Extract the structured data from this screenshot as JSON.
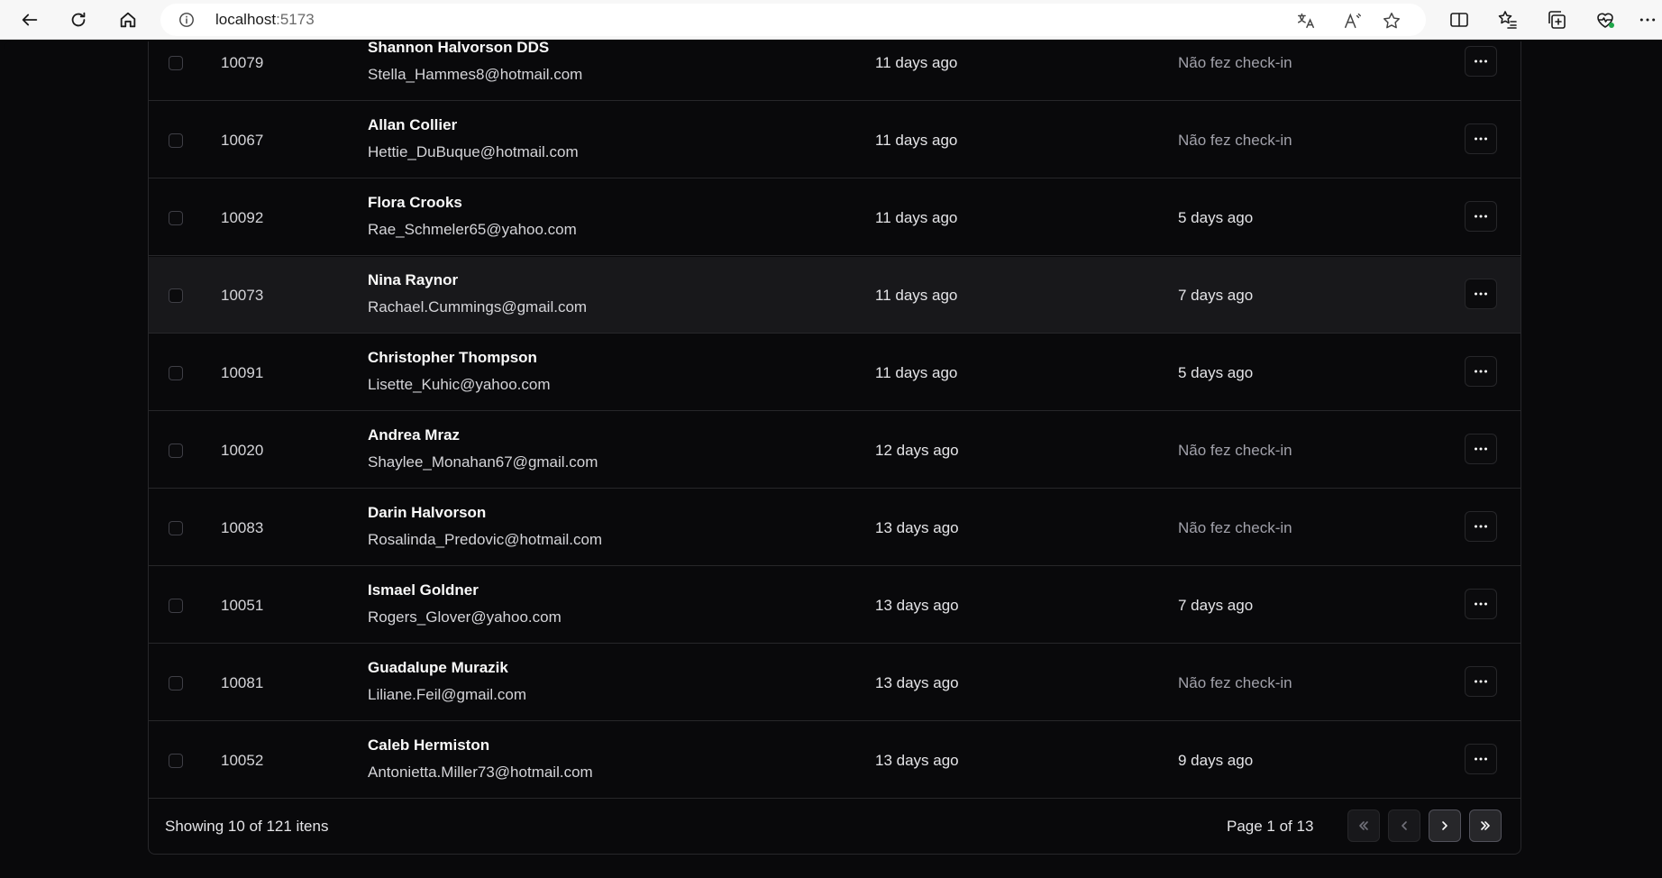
{
  "browser": {
    "url_host": "localhost",
    "url_port": ":5173"
  },
  "rows": [
    {
      "code": "10079",
      "name": "Shannon Halvorson DDS",
      "email": "Stella_Hammes8@hotmail.com",
      "created": "11 days ago",
      "checkin": "Não fez check-in"
    },
    {
      "code": "10067",
      "name": "Allan Collier",
      "email": "Hettie_DuBuque@hotmail.com",
      "created": "11 days ago",
      "checkin": "Não fez check-in"
    },
    {
      "code": "10092",
      "name": "Flora Crooks",
      "email": "Rae_Schmeler65@yahoo.com",
      "created": "11 days ago",
      "checkin": "5 days ago"
    },
    {
      "code": "10073",
      "name": "Nina Raynor",
      "email": "Rachael.Cummings@gmail.com",
      "created": "11 days ago",
      "checkin": "7 days ago"
    },
    {
      "code": "10091",
      "name": "Christopher Thompson",
      "email": "Lisette_Kuhic@yahoo.com",
      "created": "11 days ago",
      "checkin": "5 days ago"
    },
    {
      "code": "10020",
      "name": "Andrea Mraz",
      "email": "Shaylee_Monahan67@gmail.com",
      "created": "12 days ago",
      "checkin": "Não fez check-in"
    },
    {
      "code": "10083",
      "name": "Darin Halvorson",
      "email": "Rosalinda_Predovic@hotmail.com",
      "created": "13 days ago",
      "checkin": "Não fez check-in"
    },
    {
      "code": "10051",
      "name": "Ismael Goldner",
      "email": "Rogers_Glover@yahoo.com",
      "created": "13 days ago",
      "checkin": "7 days ago"
    },
    {
      "code": "10081",
      "name": "Guadalupe Murazik",
      "email": "Liliane.Feil@gmail.com",
      "created": "13 days ago",
      "checkin": "Não fez check-in"
    },
    {
      "code": "10052",
      "name": "Caleb Hermiston",
      "email": "Antonietta.Miller73@hotmail.com",
      "created": "13 days ago",
      "checkin": "9 days ago"
    }
  ],
  "footer": {
    "showing": "Showing 10 of 121 itens",
    "page": "Page 1 of 13"
  },
  "colors": {
    "background": "#09090b",
    "border": "#27272a",
    "muted_text": "#a1a1aa"
  }
}
